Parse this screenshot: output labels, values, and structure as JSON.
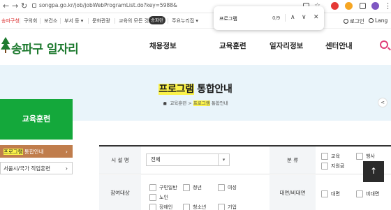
{
  "browser": {
    "url": "songpa.go.kr/job/jobWebProgramList.do?key=5988&",
    "find": {
      "query": "프로그램",
      "count": "0/9",
      "prev_glyph": "∧",
      "next_glyph": "∨",
      "close_glyph": "✕"
    },
    "nav": {
      "back": "←",
      "forward": "→",
      "reload": "↻"
    }
  },
  "gov_strip": {
    "items": [
      "송파구청",
      "구의회",
      "보건소",
      "부서 등 ▾",
      "문화관광",
      "교육의 모든 것",
      "주요누리집 ▾"
    ],
    "badge": "송파런",
    "login": "로그인",
    "language": "Lang"
  },
  "header": {
    "logo_text": "송파구 일자리",
    "menu": [
      "채용정보",
      "교육훈련",
      "일자리정보",
      "센터안내"
    ]
  },
  "hero": {
    "title_highlight": "프로그램",
    "title_rest": " 통합안내",
    "breadcrumb": {
      "home": "",
      "level1": "교육훈련",
      "sep": ">",
      "level2_highlight": "프로그램",
      "level2_rest": " 통합안내"
    }
  },
  "sidebar": {
    "title": "교육훈련",
    "items": [
      {
        "label_highlight": "프로그램",
        "label_rest": " 통합안내",
        "arrow": "›"
      },
      {
        "label": "서울시/국가 직업훈련",
        "arrow": "›"
      }
    ]
  },
  "form": {
    "facility_label": "시 설 명",
    "facility_value": "전체",
    "dropdown_glyph": "▾",
    "category_label": "분 류",
    "category_options": [
      "교육",
      "행사",
      "지원금"
    ],
    "target_label": "참여대상",
    "target_options": [
      "구민일반",
      "청년",
      "여성",
      "노인",
      "장애인",
      "청소년",
      "기업"
    ],
    "mode_label": "대면/비대면",
    "mode_options": [
      "대면",
      "비대면"
    ]
  },
  "scroll_top_glyph": "↑",
  "share_glyph": "<"
}
